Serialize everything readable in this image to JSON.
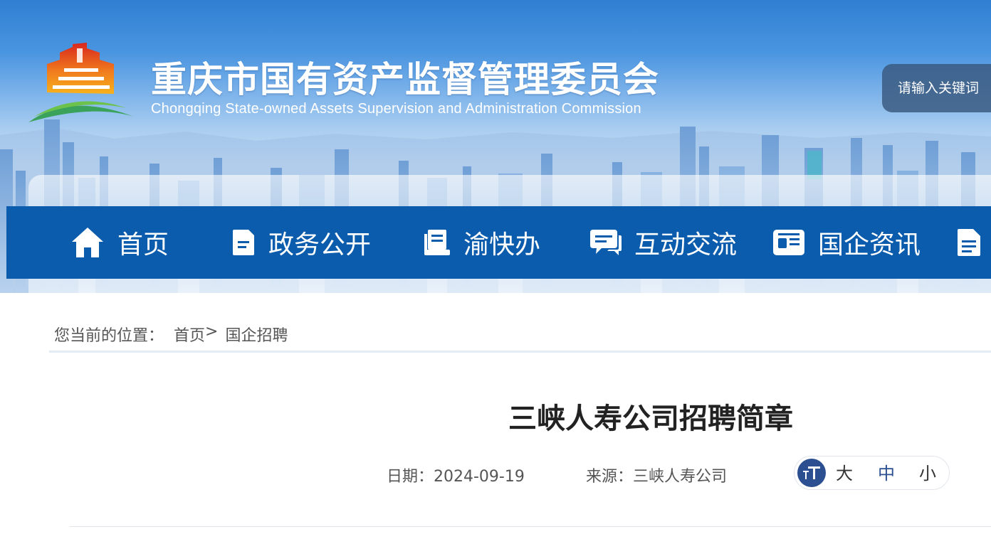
{
  "header": {
    "title": "重庆市国有资产监督管理委员会",
    "subtitle": "Chongqing State-owned Assets Supervision and Administration Commission",
    "search": {
      "placeholder": "请输入关键词"
    }
  },
  "nav": {
    "items": [
      {
        "label": "首页",
        "icon": "home-icon"
      },
      {
        "label": "政务公开",
        "icon": "document-icon"
      },
      {
        "label": "渝快办",
        "icon": "book-icon"
      },
      {
        "label": "互动交流",
        "icon": "chat-icon"
      },
      {
        "label": "国企资讯",
        "icon": "news-card-icon"
      },
      {
        "label": "",
        "icon": "file-icon"
      }
    ]
  },
  "breadcrumb": {
    "prefix": "您当前的位置：",
    "home": "首页",
    "separator": ">",
    "current": "国企招聘"
  },
  "article": {
    "title": "三峡人寿公司招聘简章",
    "date": "日期：2024-09-19",
    "source": "来源：三峡人寿公司"
  },
  "font_size_control": {
    "large": "大",
    "medium": "中",
    "small": "小",
    "active_color": "#2c4f92",
    "inactive_color": "#333333"
  },
  "colors": {
    "nav_bg": "#0b5cad",
    "accent": "#2c4f92"
  }
}
